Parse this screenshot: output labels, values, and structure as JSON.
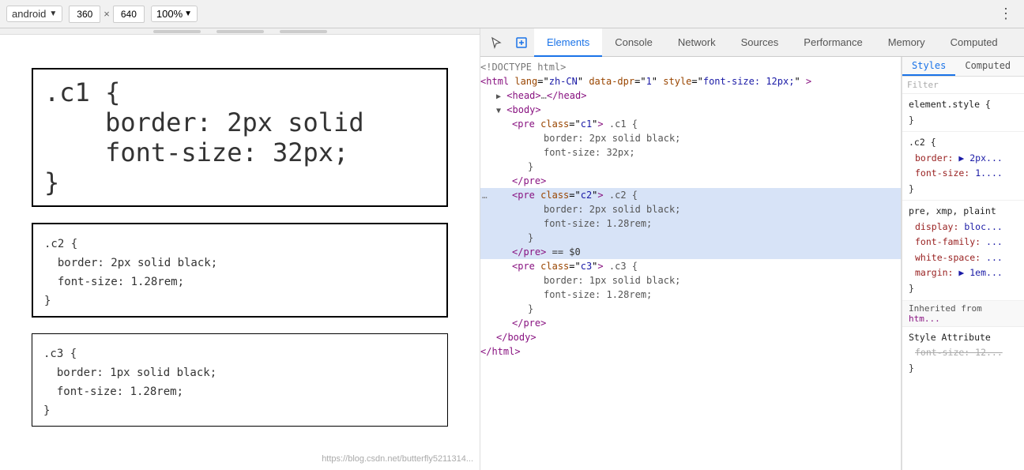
{
  "toolbar": {
    "device": "android",
    "width": "360",
    "height": "640",
    "zoom": "100%",
    "more_icon": "⋮"
  },
  "devtools_tabs": [
    {
      "label": "Elements",
      "active": true
    },
    {
      "label": "Console",
      "active": false
    },
    {
      "label": "Network",
      "active": false
    },
    {
      "label": "Sources",
      "active": false
    },
    {
      "label": "Performance",
      "active": false
    },
    {
      "label": "Memory",
      "active": false
    },
    {
      "label": "Computed",
      "active": false
    }
  ],
  "html_panel": {
    "lines": [
      {
        "indent": 0,
        "content": "&lt;!DOCTYPE html&gt;",
        "type": "comment",
        "selected": false
      },
      {
        "indent": 0,
        "content": "",
        "type": "tag-open",
        "selected": false
      },
      {
        "indent": 0,
        "content": "",
        "type": "head",
        "selected": false
      },
      {
        "indent": 0,
        "content": "",
        "type": "body-open",
        "selected": false
      },
      {
        "indent": 1,
        "content": "",
        "type": "pre-c1",
        "selected": false
      },
      {
        "indent": 2,
        "content": "border: 2px solid black;",
        "type": "text",
        "selected": false
      },
      {
        "indent": 2,
        "content": "font-size: 32px;",
        "type": "text",
        "selected": false
      },
      {
        "indent": 1,
        "content": "",
        "type": "pre-c1-close",
        "selected": false
      },
      {
        "indent": 1,
        "content": "",
        "type": "pre-c2-open",
        "selected": true
      },
      {
        "indent": 2,
        "content": "border: 2px solid black;",
        "type": "text",
        "selected": false
      },
      {
        "indent": 2,
        "content": "font-size: 1.28rem;",
        "type": "text",
        "selected": false
      },
      {
        "indent": 1,
        "content": "",
        "type": "pre-c2-close",
        "selected": true
      },
      {
        "indent": 1,
        "content": "",
        "type": "pre-c3-open",
        "selected": false
      },
      {
        "indent": 2,
        "content": "border: 1px solid black;",
        "type": "text",
        "selected": false
      },
      {
        "indent": 2,
        "content": "font-size: 1.28rem;",
        "type": "text",
        "selected": false
      },
      {
        "indent": 1,
        "content": "",
        "type": "pre-c3-close",
        "selected": false
      },
      {
        "indent": 0,
        "content": "",
        "type": "body-close",
        "selected": false
      },
      {
        "indent": 0,
        "content": "",
        "type": "html-close",
        "selected": false
      }
    ]
  },
  "styles_panel": {
    "filter_placeholder": "Filter",
    "element_style_label": "element.style {",
    "element_style_close": "}",
    "rules": [
      {
        "selector": ".c2 {",
        "props": [
          {
            "name": "border:",
            "value": "▶ 2px..."
          },
          {
            "name": "font-size:",
            "value": "1...."
          }
        ],
        "close": "}"
      }
    ],
    "pre_rule": {
      "selector": "pre, xmp, plaint",
      "props": [
        {
          "name": "display:",
          "value": "bloc..."
        },
        {
          "name": "font-family:",
          "value": "..."
        },
        {
          "name": "white-space:",
          "value": "..."
        },
        {
          "name": "margin:",
          "value": "▶ 1em..."
        }
      ],
      "close": "}"
    },
    "inherited_label": "Inherited from",
    "inherited_from": "htm...",
    "style_attribute_label": "Style Attribute",
    "style_attr_prop": "font-size: 12...",
    "style_attr_close": "}"
  },
  "preview": {
    "c1_text": ".c1 {\n    border: 2px solid\n    font-size: 32px;\n}",
    "c2_text": ".c2 {\n  border: 2px solid black;\n  font-size: 1.28rem;\n}",
    "c3_text": ".c3 {\n  border: 1px solid black;\n  font-size: 1.28rem;\n}",
    "url": "https://blog.csdn.net/butterfly5211314..."
  }
}
